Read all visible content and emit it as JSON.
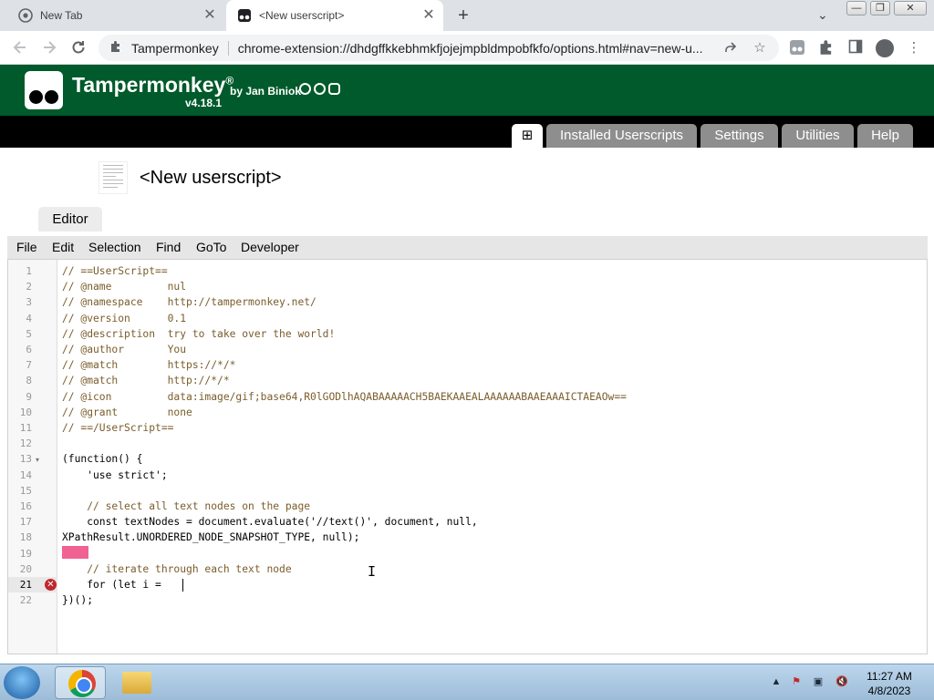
{
  "browser": {
    "tabs": [
      {
        "title": "New Tab",
        "icon": "chrome-icon"
      },
      {
        "title": "<New userscript>",
        "icon": "tampermonkey-icon"
      }
    ],
    "new_tab": "+",
    "tab_search": "⌄",
    "window_controls": [
      "—",
      "❐",
      "✕"
    ],
    "origin": "Tampermonkey",
    "url": "chrome-extension://dhdgffkkebhmkfjojejmpbldmpobfkfo/options.html#nav=new-u..."
  },
  "tm": {
    "title": "Tampermonkey",
    "reg": "®",
    "by": "by Jan Biniok",
    "version": "v4.18.1",
    "nav": {
      "add": "⊞",
      "tabs": [
        "Installed Userscripts",
        "Settings",
        "Utilities",
        "Help"
      ]
    }
  },
  "script": {
    "title": "<New userscript>"
  },
  "editor": {
    "tab_label": "Editor",
    "menu": [
      "File",
      "Edit",
      "Selection",
      "Find",
      "GoTo",
      "Developer"
    ],
    "active_line": "21",
    "line_numbers": [
      "1",
      "2",
      "3",
      "4",
      "5",
      "6",
      "7",
      "8",
      "9",
      "10",
      "11",
      "12",
      "13",
      "14",
      "15",
      "16",
      "17",
      "18",
      "19",
      "20",
      "21",
      "22"
    ],
    "lines": [
      "// ==UserScript==",
      "// @name         nul",
      "// @namespace    http://tampermonkey.net/",
      "// @version      0.1",
      "// @description  try to take over the world!",
      "// @author       You",
      "// @match        https://*/*",
      "// @match        http://*/*",
      "// @icon         data:image/gif;base64,R0lGODlhAQABAAAAACH5BAEKAAEALAAAAAABAAEAAAICTAEAOw==",
      "// @grant        none",
      "// ==/UserScript==",
      "",
      "(function() {",
      "    'use strict';",
      "",
      "    // select all text nodes on the page",
      "    const textNodes = document.evaluate('//text()', document, null,",
      "XPathResult.UNORDERED_NODE_SNAPSHOT_TYPE, null);",
      "",
      "    // iterate through each text node",
      "    for (let i = ",
      "})();"
    ],
    "error_glyph": "✕",
    "fold_glyph": "▾"
  },
  "taskbar": {
    "time": "11:27 AM",
    "date": "4/8/2023",
    "tray_icons": [
      "▲",
      "⚑",
      "▣",
      "🔇"
    ]
  },
  "colors": {
    "tm_green": "#005a2b",
    "nav_tab": "#8e8e8e",
    "error": "#c0272d",
    "highlight": "#f06292"
  }
}
